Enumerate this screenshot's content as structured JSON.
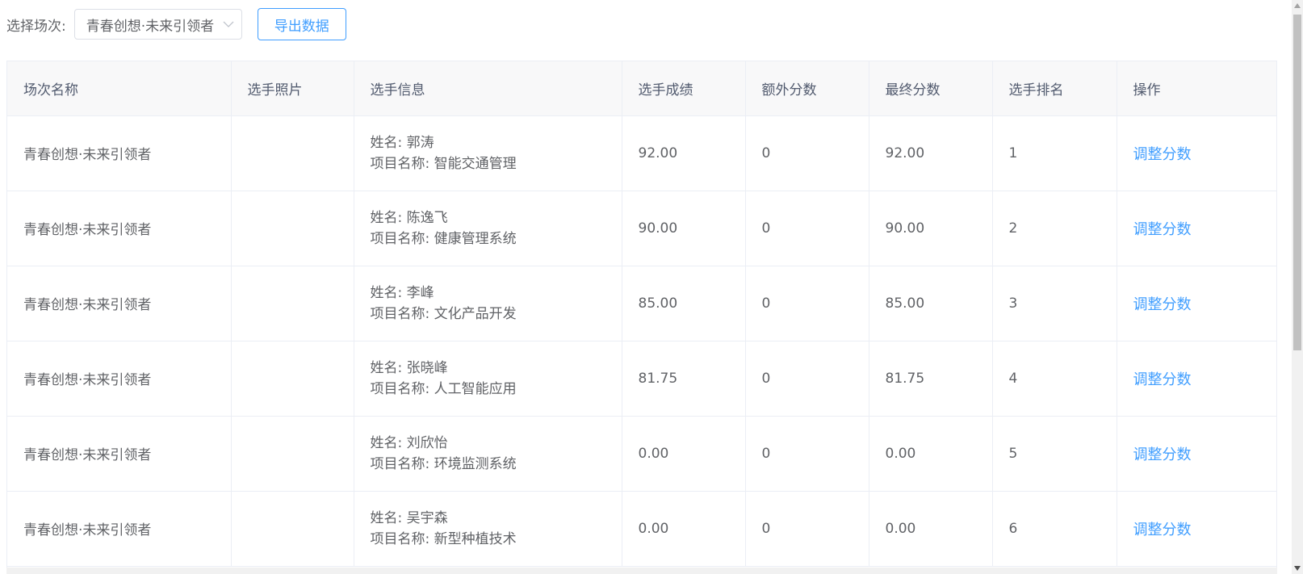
{
  "toolbar": {
    "label": "选择场次:",
    "selected_session": "青春创想·未来引领者",
    "export_label": "导出数据"
  },
  "table": {
    "headers": [
      "场次名称",
      "选手照片",
      "选手信息",
      "选手成绩",
      "额外分数",
      "最终分数",
      "选手排名",
      "操作"
    ],
    "rows": [
      {
        "session": "青春创想·未来引领者",
        "name": "姓名: 郭涛",
        "project": "项目名称: 智能交通管理",
        "score": "92.00",
        "extra": "0",
        "final": "92.00",
        "rank": "1",
        "action": "调整分数"
      },
      {
        "session": "青春创想·未来引领者",
        "name": "姓名: 陈逸飞",
        "project": "项目名称: 健康管理系统",
        "score": "90.00",
        "extra": "0",
        "final": "90.00",
        "rank": "2",
        "action": "调整分数"
      },
      {
        "session": "青春创想·未来引领者",
        "name": "姓名: 李峰",
        "project": "项目名称: 文化产品开发",
        "score": "85.00",
        "extra": "0",
        "final": "85.00",
        "rank": "3",
        "action": "调整分数"
      },
      {
        "session": "青春创想·未来引领者",
        "name": "姓名: 张晓峰",
        "project": "项目名称: 人工智能应用",
        "score": "81.75",
        "extra": "0",
        "final": "81.75",
        "rank": "4",
        "action": "调整分数"
      },
      {
        "session": "青春创想·未来引领者",
        "name": "姓名: 刘欣怡",
        "project": "项目名称: 环境监测系统",
        "score": "0.00",
        "extra": "0",
        "final": "0.00",
        "rank": "5",
        "action": "调整分数"
      },
      {
        "session": "青春创想·未来引领者",
        "name": "姓名: 吴宇森",
        "project": "项目名称: 新型种植技术",
        "score": "0.00",
        "extra": "0",
        "final": "0.00",
        "rank": "6",
        "action": "调整分数"
      }
    ]
  },
  "colors": {
    "accent": "#409eff",
    "text": "#606266",
    "header_bg": "#f8f8f9",
    "border": "#ebeef5"
  },
  "icons": {
    "select_arrow": "chevron-down-icon"
  }
}
